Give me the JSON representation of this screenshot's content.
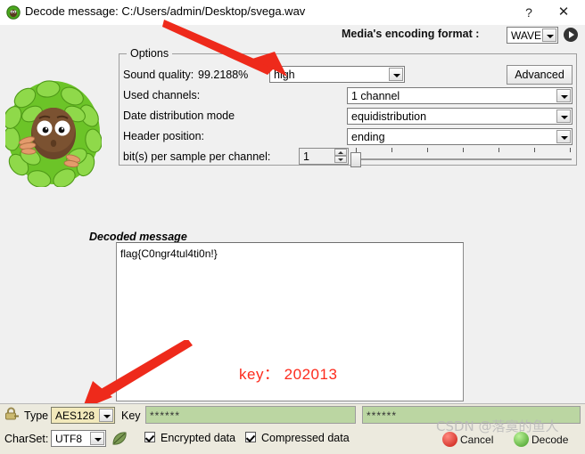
{
  "window": {
    "title": "Decode message: C:/Users/admin/Desktop/svega.wav",
    "icon": "app-mascot-icon",
    "help_label": "?",
    "close_label": "✕"
  },
  "header": {
    "encoding_label": "Media's encoding format :",
    "encoding_value": "WAVE",
    "play_icon": "play-icon"
  },
  "options": {
    "group_title": "Options",
    "sound_quality_label": "Sound quality:",
    "sound_quality_percent": "99.2188%",
    "sound_quality_value": "high",
    "advanced_label": "Advanced",
    "used_channels_label": "Used channels:",
    "used_channels_value": "1 channel",
    "date_distribution_label": "Date distribution mode",
    "date_distribution_value": "equidistribution",
    "header_position_label": "Header position:",
    "header_position_value": "ending",
    "bits_label": "bit(s) per sample per channel:",
    "bits_value": "1"
  },
  "decoded": {
    "label": "Decoded message",
    "text": "flag{C0ngr4tul4ti0n!}"
  },
  "annotation": {
    "key_note": "key： 202013",
    "color": "#fd2a1c"
  },
  "bottom": {
    "lock_icon": "lock-icon",
    "type_label": "Type",
    "type_value": "AES128",
    "key_label": "Key",
    "key_value": "******",
    "key_confirm_value": "******",
    "charset_label": "CharSet:",
    "charset_value": "UTF8",
    "leaf_icon": "leaf-icon",
    "encrypted_label": "Encrypted data",
    "compressed_label": "Compressed data",
    "cancel_label": "Cancel",
    "decode_label": "Decode"
  },
  "watermark": {
    "text": "CSDN @落寞的鱼人"
  }
}
